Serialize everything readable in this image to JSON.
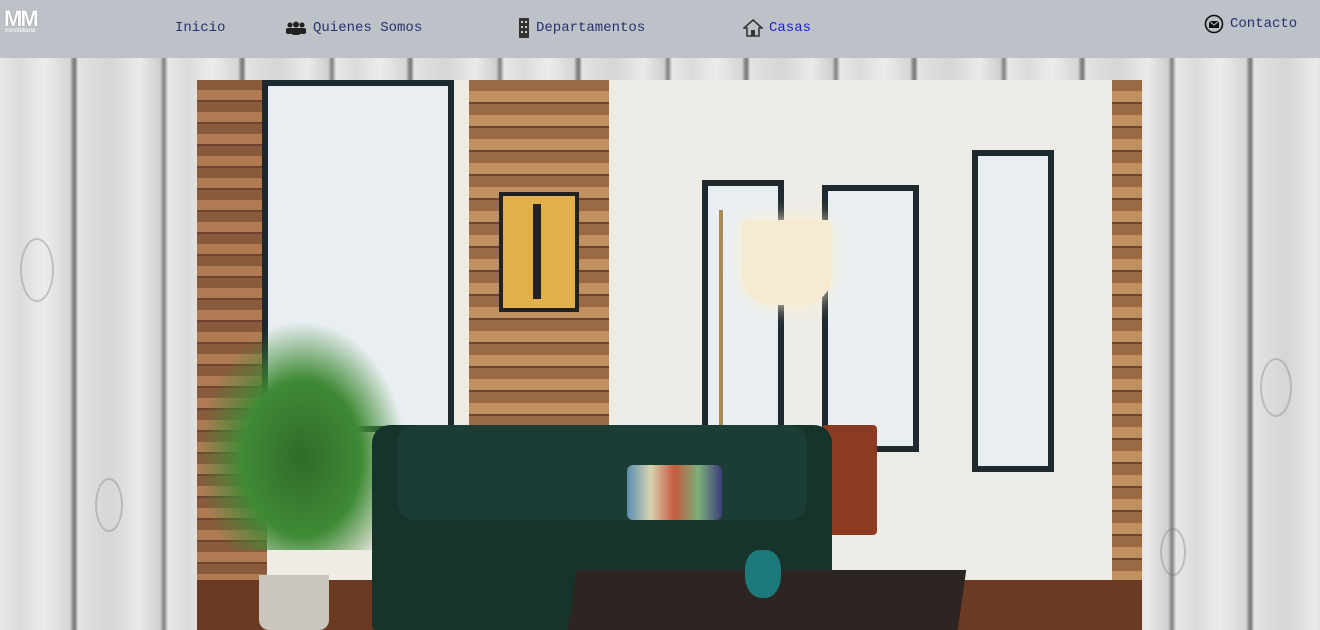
{
  "logo": {
    "mark": "MM",
    "sub": "inmobiliaria"
  },
  "nav": {
    "inicio": "Inicio",
    "quienes": "Quienes Somos",
    "departamentos": "Departamentos",
    "casas": "Casas",
    "contacto": "Contacto"
  },
  "icons": {
    "quienes": "group-icon",
    "departamentos": "building-icon",
    "casas": "house-icon",
    "contacto": "envelope-icon"
  },
  "colors": {
    "navbar": "#bcc2c7",
    "nav_text": "#2a2f6e",
    "nav_active": "#1d1dcc"
  }
}
